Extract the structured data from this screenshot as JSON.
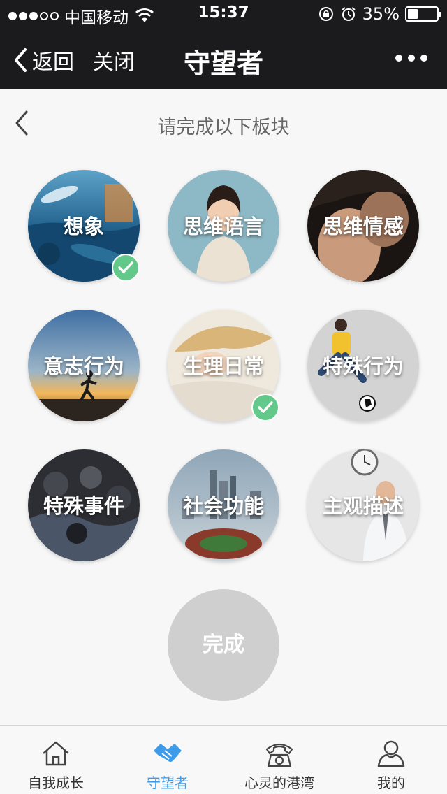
{
  "status_bar": {
    "carrier": "中国移动",
    "time": "15:37",
    "battery": "35%",
    "battery_level": 0.35
  },
  "nav": {
    "back_label": "返回",
    "close_label": "关闭",
    "title": "守望者"
  },
  "section": {
    "title": "请完成以下板块"
  },
  "modules": [
    {
      "label": "想象",
      "completed": true,
      "icon": "imagination-photo"
    },
    {
      "label": "思维语言",
      "completed": false,
      "icon": "thinking-language-photo"
    },
    {
      "label": "思维情感",
      "completed": false,
      "icon": "thinking-emotion-photo"
    },
    {
      "label": "意志行为",
      "completed": false,
      "icon": "will-behavior-photo"
    },
    {
      "label": "生理日常",
      "completed": true,
      "icon": "physiology-daily-photo"
    },
    {
      "label": "特殊行为",
      "completed": false,
      "icon": "special-behavior-photo"
    },
    {
      "label": "特殊事件",
      "completed": false,
      "icon": "special-event-photo"
    },
    {
      "label": "社会功能",
      "completed": false,
      "icon": "social-function-photo"
    },
    {
      "label": "主观描述",
      "completed": false,
      "icon": "subjective-description-photo"
    }
  ],
  "done_button": {
    "label": "完成"
  },
  "tabbar": {
    "items": [
      {
        "label": "自我成长",
        "icon": "home-icon",
        "active": false
      },
      {
        "label": "守望者",
        "icon": "handshake-icon",
        "active": true
      },
      {
        "label": "心灵的港湾",
        "icon": "telephone-icon",
        "active": false
      },
      {
        "label": "我的",
        "icon": "user-icon",
        "active": false
      }
    ]
  },
  "colors": {
    "nav_background": "#1b1b1d",
    "check_green": "#63c98a",
    "tab_active": "#3d9be9",
    "done_gray": "#cfcfcf"
  }
}
